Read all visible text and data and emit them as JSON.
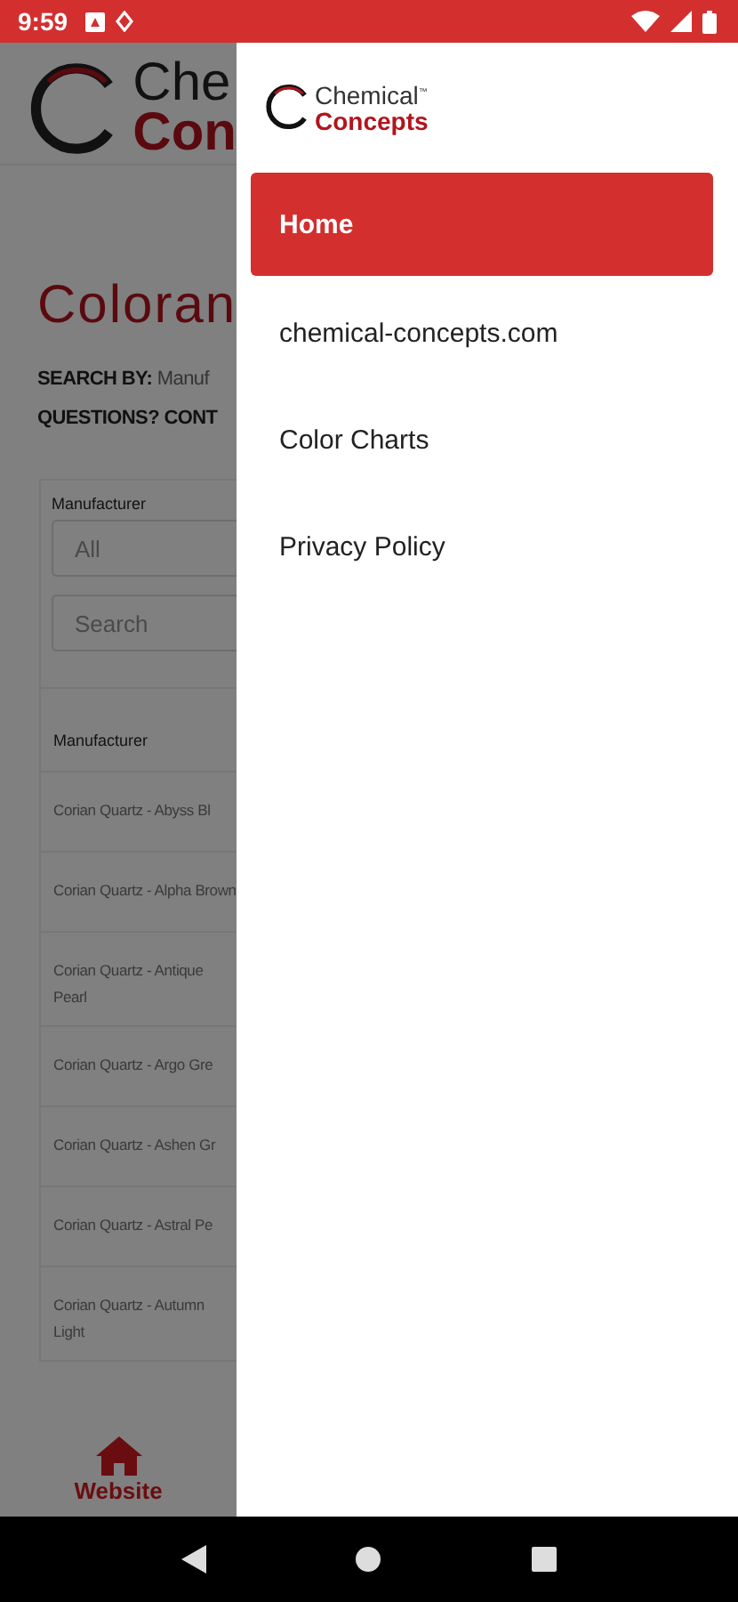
{
  "status_bar": {
    "time": "9:59"
  },
  "background_page": {
    "logo": {
      "line_1": "Che",
      "line_2": "Con"
    },
    "title": "Coloran",
    "search_by": {
      "label": "SEARCH BY:",
      "value": "Manuf"
    },
    "questions": "QUESTIONS? CONT",
    "filter": {
      "label": "Manufacturer",
      "select_value": "All",
      "search_placeholder": "Search"
    },
    "table": {
      "column": "Manufacturer",
      "rows": [
        "Corian Quartz - Abyss Bl",
        "Corian Quartz - Alpha Brown",
        "Corian Quartz - Antique Pearl",
        "Corian Quartz - Argo Gre",
        "Corian Quartz - Ashen Gr",
        "Corian Quartz - Astral Pe",
        "Corian Quartz - Autumn Light"
      ]
    },
    "bottom_tab": {
      "label": "Website"
    }
  },
  "drawer": {
    "logo": {
      "line_1": "Chemical",
      "trademark": "™",
      "line_2": "Concepts"
    },
    "items": [
      {
        "label": "Home",
        "selected": true
      },
      {
        "label": "chemical-concepts.com",
        "selected": false
      },
      {
        "label": "Color Charts",
        "selected": false
      },
      {
        "label": "Privacy Policy",
        "selected": false
      }
    ]
  }
}
